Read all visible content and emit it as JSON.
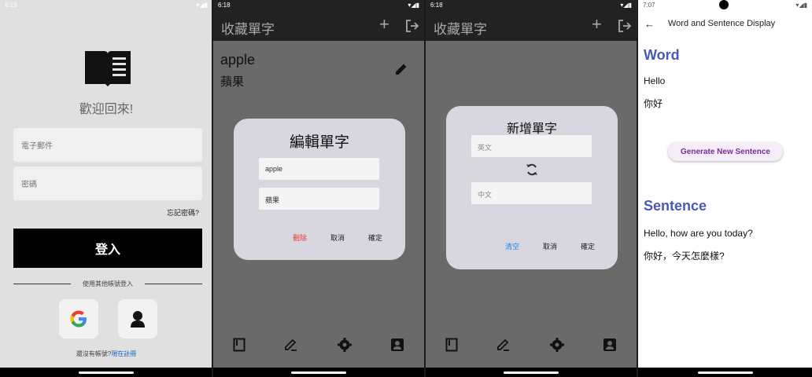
{
  "login": {
    "status_time": "6:19",
    "welcome": "歡迎回來!",
    "email_placeholder": "電子郵件",
    "password_placeholder": "密碼",
    "forgot": "忘記密碼?",
    "login_button": "登入",
    "other_methods": "使用其他帳號登入",
    "no_account": "還沒有帳號?",
    "register": "現在註冊"
  },
  "edit_screen": {
    "status_time": "6:18",
    "title": "收藏單字",
    "word_en": "apple",
    "word_zh": "蘋果",
    "dialog": {
      "title": "編輯單字",
      "field_en": "apple",
      "field_zh": "蘋果",
      "delete": "刪除",
      "cancel": "取消",
      "confirm": "確定"
    }
  },
  "add_screen": {
    "status_time": "6:18",
    "title": "收藏單字",
    "dialog": {
      "title": "新增單字",
      "en_placeholder": "英文",
      "zh_placeholder": "中文",
      "clear": "清空",
      "cancel": "取消",
      "confirm": "確定"
    }
  },
  "word_display": {
    "status_time": "7:07",
    "appbar_title": "Word and Sentence Display",
    "word_heading": "Word",
    "word_en": "Hello",
    "word_zh": "你好",
    "generate_button": "Generate New Sentence",
    "sentence_heading": "Sentence",
    "sentence_en": "Hello, how are you today?",
    "sentence_zh": "你好，今天怎麼樣?"
  },
  "colors": {
    "accent_blue": "#4a58b6",
    "delete_red": "#e53935",
    "clear_blue": "#1e88e5",
    "button_purple": "#7a2b9a"
  }
}
